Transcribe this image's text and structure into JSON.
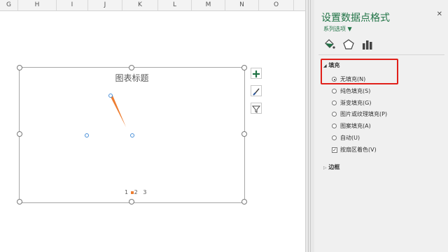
{
  "columns": [
    "G",
    "H",
    "I",
    "J",
    "K",
    "L",
    "M",
    "N",
    "O"
  ],
  "chart": {
    "title": "图表标题",
    "legend_items": [
      "1",
      "2",
      "3"
    ],
    "series_color": "#ed7d31"
  },
  "pane": {
    "title": "设置数据点格式",
    "close_glyph": "✕",
    "subtitle": "系列选项 ▼",
    "fill_section": "填充",
    "border_section": "边框",
    "fill_options": [
      {
        "label": "无填充(N)",
        "selected": true
      },
      {
        "label": "纯色填充(S)",
        "selected": false
      },
      {
        "label": "渐变填充(G)",
        "selected": false
      },
      {
        "label": "图片或纹理填充(P)",
        "selected": false
      },
      {
        "label": "图案填充(A)",
        "selected": false
      },
      {
        "label": "自动(U)",
        "selected": false
      }
    ],
    "vary_colors": {
      "label": "按扇区着色(V)",
      "checked": true
    },
    "accent_color": "#217346",
    "highlight_color": "#e0201a",
    "icons": [
      "fill-bucket-icon",
      "pentagon-icon",
      "bar-chart-icon"
    ]
  },
  "chart_buttons": [
    "plus-icon",
    "brush-icon",
    "filter-icon"
  ]
}
